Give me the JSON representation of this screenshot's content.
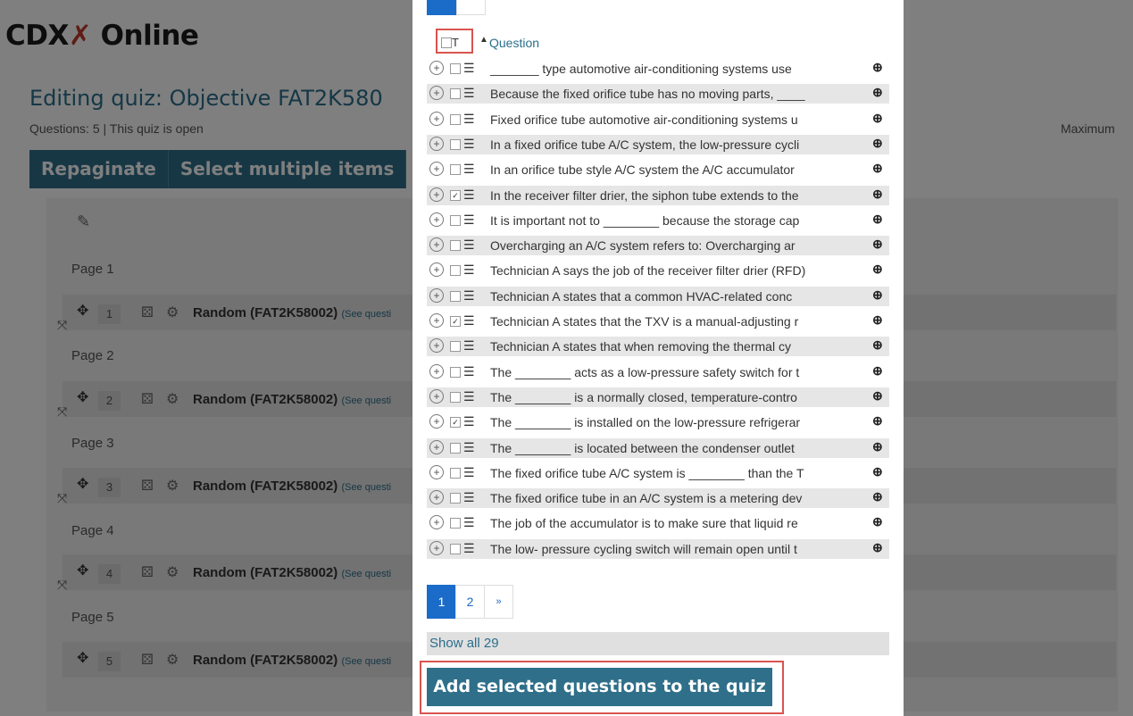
{
  "background": {
    "logo_part1": "CDX",
    "logo_part2": "Online",
    "title": "Editing quiz: Objective FAT2K580",
    "info": "Questions: 5 | This quiz is open",
    "maximum": "Maximum",
    "buttons": [
      "Repaginate",
      "Select multiple items"
    ],
    "pages": [
      {
        "label": "Page 1",
        "num": "1",
        "text": "Random (FAT2K58002)",
        "see": "(See questi"
      },
      {
        "label": "Page 2",
        "num": "2",
        "text": "Random (FAT2K58002)",
        "see": "(See questi"
      },
      {
        "label": "Page 3",
        "num": "3",
        "text": "Random (FAT2K58002)",
        "see": "(See questi"
      },
      {
        "label": "Page 4",
        "num": "4",
        "text": "Random (FAT2K58002)",
        "see": "(See questi"
      },
      {
        "label": "Page 5",
        "num": "5",
        "text": "Random (FAT2K58002)",
        "see": "(See questi"
      }
    ]
  },
  "modal": {
    "header": {
      "select_all_label": "T",
      "sort_arrow": "▲",
      "column": "Question"
    },
    "questions": [
      {
        "checked": false,
        "text": "_______ type automotive air-conditioning systems use"
      },
      {
        "checked": false,
        "text": "Because the fixed orifice tube has no moving parts, ____"
      },
      {
        "checked": false,
        "text": "Fixed orifice tube automotive air-conditioning systems u"
      },
      {
        "checked": false,
        "text": "In a fixed orifice tube A/C system, the low-pressure cycli"
      },
      {
        "checked": false,
        "text": "In an orifice tube style A/C system the A/C accumulator"
      },
      {
        "checked": true,
        "text": "In the receiver filter drier, the siphon tube extends to the"
      },
      {
        "checked": false,
        "text": "It is important not to ________ because the storage cap"
      },
      {
        "checked": false,
        "text": "Overcharging an A/C system refers to: Overcharging ar"
      },
      {
        "checked": false,
        "text": "Technician A says the job of the receiver filter drier (RFD)"
      },
      {
        "checked": false,
        "text": "Technician A states that a common HVAC-related conc"
      },
      {
        "checked": true,
        "text": "Technician A states that the TXV is a manual-adjusting r"
      },
      {
        "checked": false,
        "text": "Technician A states that when removing the thermal cy"
      },
      {
        "checked": false,
        "text": "The ________ acts as a low-pressure safety switch for t"
      },
      {
        "checked": false,
        "text": "The ________ is a normally closed, temperature-contro"
      },
      {
        "checked": true,
        "text": "The ________ is installed on the low-pressure refrigerar"
      },
      {
        "checked": false,
        "text": "The ________ is located between the condenser outlet"
      },
      {
        "checked": false,
        "text": "The fixed orifice tube A/C system is ________ than the T"
      },
      {
        "checked": false,
        "text": "The fixed orifice tube in an A/C system is a metering dev"
      },
      {
        "checked": false,
        "text": "The job of the accumulator is to make sure that liquid re"
      },
      {
        "checked": false,
        "text": "The low- pressure cycling switch will remain open until t"
      }
    ],
    "pager": {
      "pages": [
        "1",
        "2"
      ],
      "next": "»"
    },
    "show_all": "Show all 29",
    "add_button": "Add selected questions to the quiz"
  },
  "colors": {
    "accent": "#2f6f8a",
    "link": "#2a6e8c",
    "highlight": "#d9534f",
    "active_page": "#1b6cc9"
  }
}
